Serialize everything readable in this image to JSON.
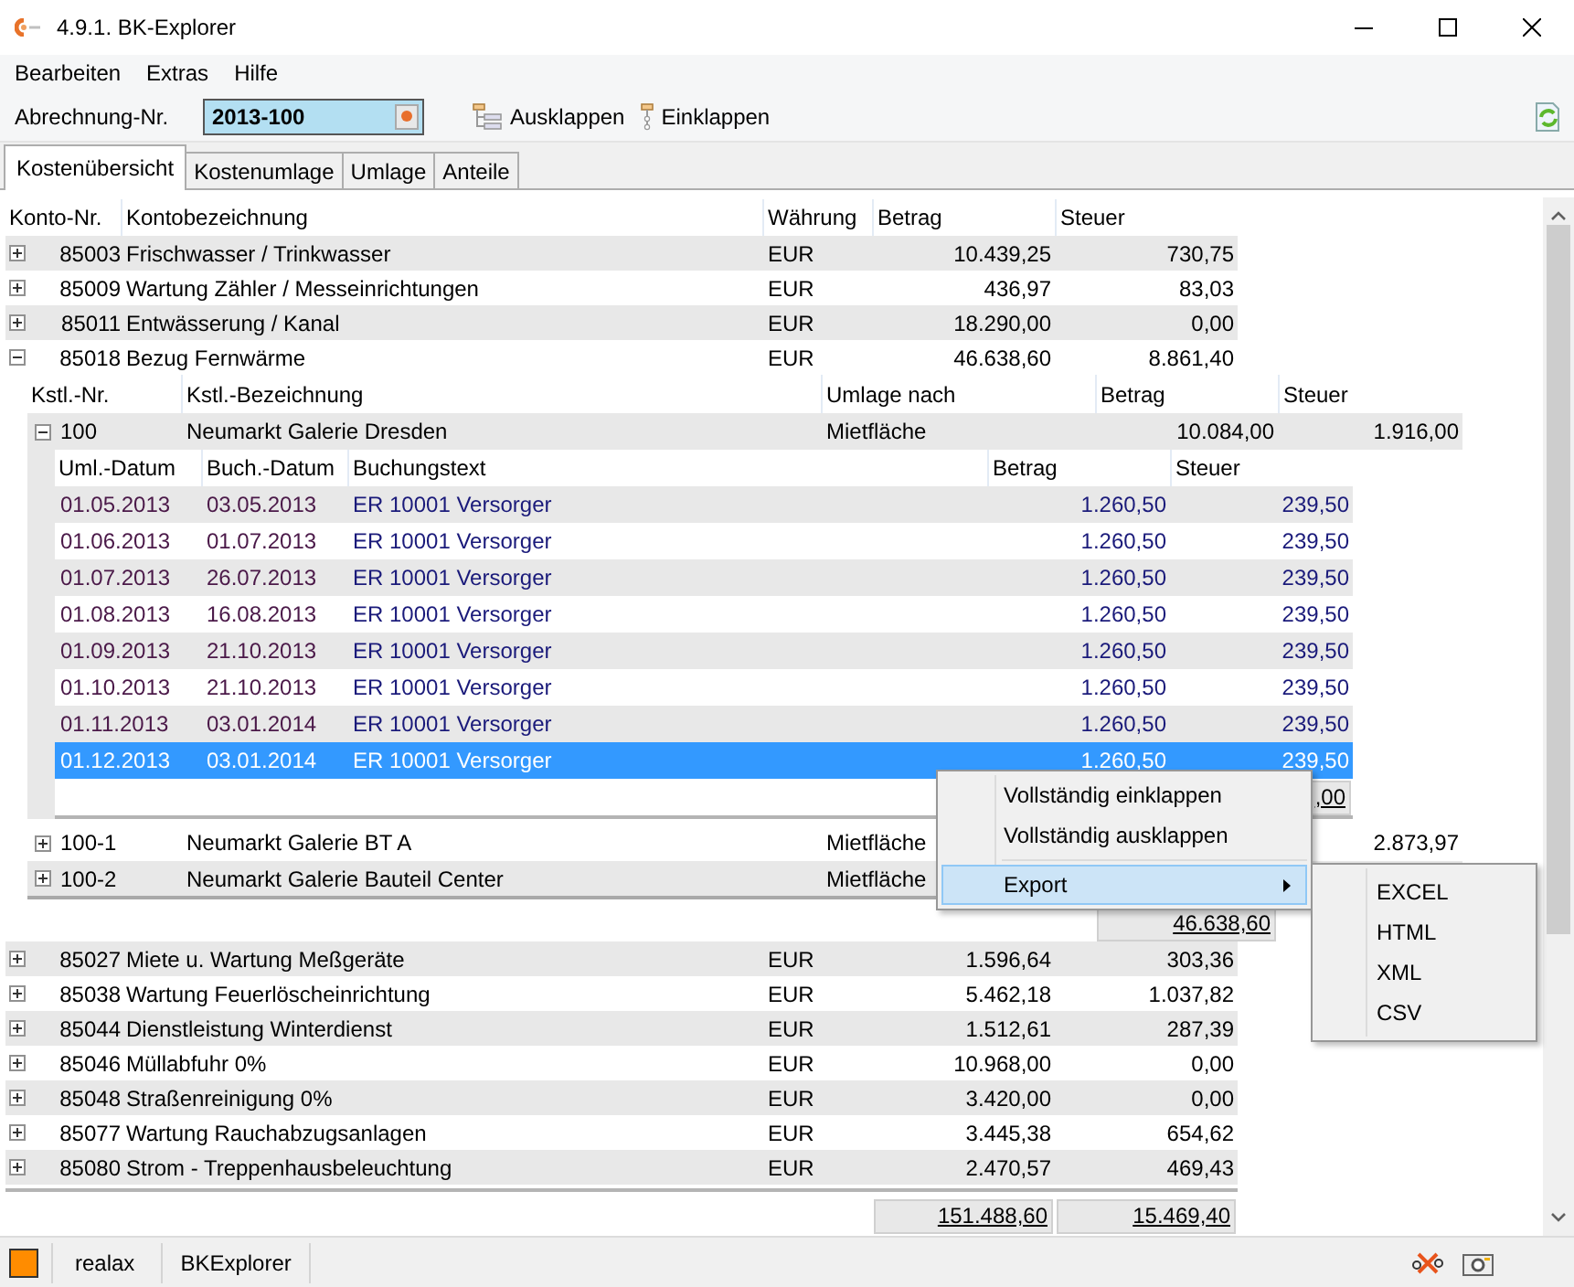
{
  "window": {
    "title": "4.9.1. BK-Explorer"
  },
  "menu": [
    "Bearbeiten",
    "Extras",
    "Hilfe"
  ],
  "toolbar": {
    "label": "Abrechnung-Nr.",
    "value": "2013-100",
    "buttons": [
      {
        "kind": "expand",
        "label": "Ausklappen"
      },
      {
        "kind": "collapse",
        "label": "Einklappen"
      }
    ]
  },
  "tabs": [
    {
      "label": "Kostenübersicht",
      "selected": true
    },
    {
      "label": "Kostenumlage",
      "selected": false
    },
    {
      "label": "Umlage",
      "selected": false
    },
    {
      "label": "Anteile",
      "selected": false
    }
  ],
  "accounts": {
    "columns": [
      "Konto-Nr.",
      "Kontobezeichnung",
      "Währung",
      "Betrag",
      "Steuer"
    ],
    "rows": [
      {
        "number": "85003",
        "name": "Frischwasser / Trinkwasser",
        "currency": "EUR",
        "amount": "10.439,25",
        "tax": "730,75",
        "expanded": false
      },
      {
        "number": "85009",
        "name": "Wartung Zähler / Messeinrichtungen",
        "currency": "EUR",
        "amount": "436,97",
        "tax": "83,03",
        "expanded": false
      },
      {
        "number": "85011",
        "name": "Entwässerung / Kanal",
        "currency": "EUR",
        "amount": "18.290,00",
        "tax": "0,00",
        "expanded": false
      },
      {
        "number": "85018",
        "name": "Bezug Fernwärme",
        "currency": "EUR",
        "amount": "46.638,60",
        "tax": "8.861,40",
        "expanded": true,
        "cost_centers": {
          "columns": [
            "Kstl.-Nr.",
            "Kstl.-Bezeichnung",
            "Umlage nach",
            "Betrag",
            "Steuer"
          ],
          "rows": [
            {
              "number": "100",
              "name": "Neumarkt Galerie Dresden",
              "allocation": "Mietfläche",
              "amount": "10.084,00",
              "tax": "1.916,00",
              "expanded": true,
              "bookings": {
                "columns": [
                  "Uml.-Datum",
                  "Buch.-Datum",
                  "Buchungstext",
                  "Betrag",
                  "Steuer"
                ],
                "rows": [
                  {
                    "allocation_date": "01.05.2013",
                    "booking_date": "03.05.2013",
                    "text": "ER 10001 Versorger",
                    "amount": "1.260,50",
                    "tax": "239,50",
                    "selected": false
                  },
                  {
                    "allocation_date": "01.06.2013",
                    "booking_date": "01.07.2013",
                    "text": "ER 10001 Versorger",
                    "amount": "1.260,50",
                    "tax": "239,50",
                    "selected": false
                  },
                  {
                    "allocation_date": "01.07.2013",
                    "booking_date": "26.07.2013",
                    "text": "ER 10001 Versorger",
                    "amount": "1.260,50",
                    "tax": "239,50",
                    "selected": false
                  },
                  {
                    "allocation_date": "01.08.2013",
                    "booking_date": "16.08.2013",
                    "text": "ER 10001 Versorger",
                    "amount": "1.260,50",
                    "tax": "239,50",
                    "selected": false
                  },
                  {
                    "allocation_date": "01.09.2013",
                    "booking_date": "21.10.2013",
                    "text": "ER 10001 Versorger",
                    "amount": "1.260,50",
                    "tax": "239,50",
                    "selected": false
                  },
                  {
                    "allocation_date": "01.10.2013",
                    "booking_date": "21.10.2013",
                    "text": "ER 10001 Versorger",
                    "amount": "1.260,50",
                    "tax": "239,50",
                    "selected": false
                  },
                  {
                    "allocation_date": "01.11.2013",
                    "booking_date": "03.01.2014",
                    "text": "ER 10001 Versorger",
                    "amount": "1.260,50",
                    "tax": "239,50",
                    "selected": false
                  },
                  {
                    "allocation_date": "01.12.2013",
                    "booking_date": "03.01.2014",
                    "text": "ER 10001 Versorger",
                    "amount": "1.260,50",
                    "tax": "239,50",
                    "selected": true
                  }
                ],
                "totals": {
                  "tax": ",00"
                }
              }
            },
            {
              "number": "100-1",
              "name": "Neumarkt Galerie BT A",
              "allocation": "Mietfläche",
              "tax": "2.873,97",
              "expanded": false
            },
            {
              "number": "100-2",
              "name": "Neumarkt Galerie Bauteil Center",
              "allocation": "Mietfläche",
              "expanded": false
            }
          ],
          "totals": {
            "amount": "46.638,60"
          }
        }
      },
      {
        "number": "85027",
        "name": "Miete u. Wartung Meßgeräte",
        "currency": "EUR",
        "amount": "1.596,64",
        "tax": "303,36",
        "expanded": false
      },
      {
        "number": "85038",
        "name": "Wartung Feuerlöscheinrichtung",
        "currency": "EUR",
        "amount": "5.462,18",
        "tax": "1.037,82",
        "expanded": false
      },
      {
        "number": "85044",
        "name": "Dienstleistung Winterdienst",
        "currency": "EUR",
        "amount": "1.512,61",
        "tax": "287,39",
        "expanded": false
      },
      {
        "number": "85046",
        "name": "Müllabfuhr 0%",
        "currency": "EUR",
        "amount": "10.968,00",
        "tax": "0,00",
        "expanded": false
      },
      {
        "number": "85048",
        "name": "Straßenreinigung 0%",
        "currency": "EUR",
        "amount": "3.420,00",
        "tax": "0,00",
        "expanded": false
      },
      {
        "number": "85077",
        "name": "Wartung Rauchabzugsanlagen",
        "currency": "EUR",
        "amount": "3.445,38",
        "tax": "654,62",
        "expanded": false
      },
      {
        "number": "85080",
        "name": "Strom - Treppenhausbeleuchtung",
        "currency": "EUR",
        "amount": "2.470,57",
        "tax": "469,43",
        "expanded": false
      }
    ],
    "totals": {
      "amount": "151.488,60",
      "tax": "15.469,40"
    }
  },
  "context_menu": {
    "items": [
      {
        "kind": "item",
        "label": "Vollständig einklappen",
        "selected": false,
        "has_submenu": false
      },
      {
        "kind": "item",
        "label": "Vollständig ausklappen",
        "selected": false,
        "has_submenu": false
      },
      {
        "kind": "separator"
      },
      {
        "kind": "item",
        "label": "Export",
        "selected": true,
        "has_submenu": true
      }
    ],
    "submenu": [
      "EXCEL",
      "HTML",
      "XML",
      "CSV"
    ]
  },
  "status_bar": {
    "items": [
      "realax",
      "BKExplorer"
    ]
  }
}
